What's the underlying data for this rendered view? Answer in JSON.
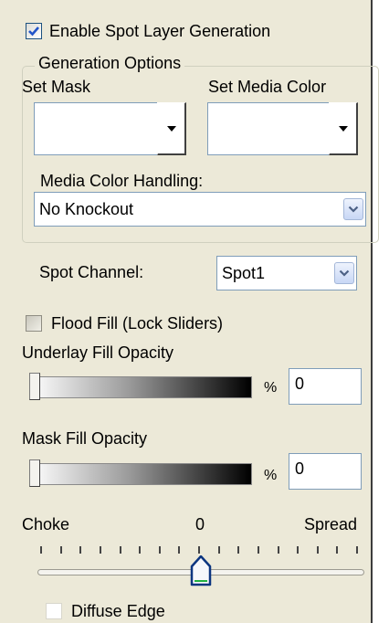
{
  "enable_spot": {
    "label": "Enable Spot Layer Generation",
    "checked": true
  },
  "generation_options": {
    "legend": "Generation Options",
    "set_mask_label": "Set Mask",
    "set_media_color_label": "Set Media Color",
    "media_color_handling_label": "Media Color Handling:",
    "media_color_handling_value": "No Knockout"
  },
  "spot_channel": {
    "label": "Spot Channel:",
    "value": "Spot1"
  },
  "flood_fill": {
    "label": "Flood Fill (Lock Sliders)",
    "checked": false
  },
  "underlay": {
    "label": "Underlay Fill Opacity",
    "unit": "%",
    "value": "0"
  },
  "mask_fill": {
    "label": "Mask Fill Opacity",
    "unit": "%",
    "value": "0"
  },
  "choke_spread": {
    "left_label": "Choke",
    "center_value": "0",
    "right_label": "Spread",
    "position": 0.5
  },
  "diffuse_edge": {
    "label": "Diffuse Edge",
    "checked": false
  },
  "colors": {
    "accent": "#1c5180",
    "panel": "#ece9d8",
    "check": "#2154c9"
  }
}
